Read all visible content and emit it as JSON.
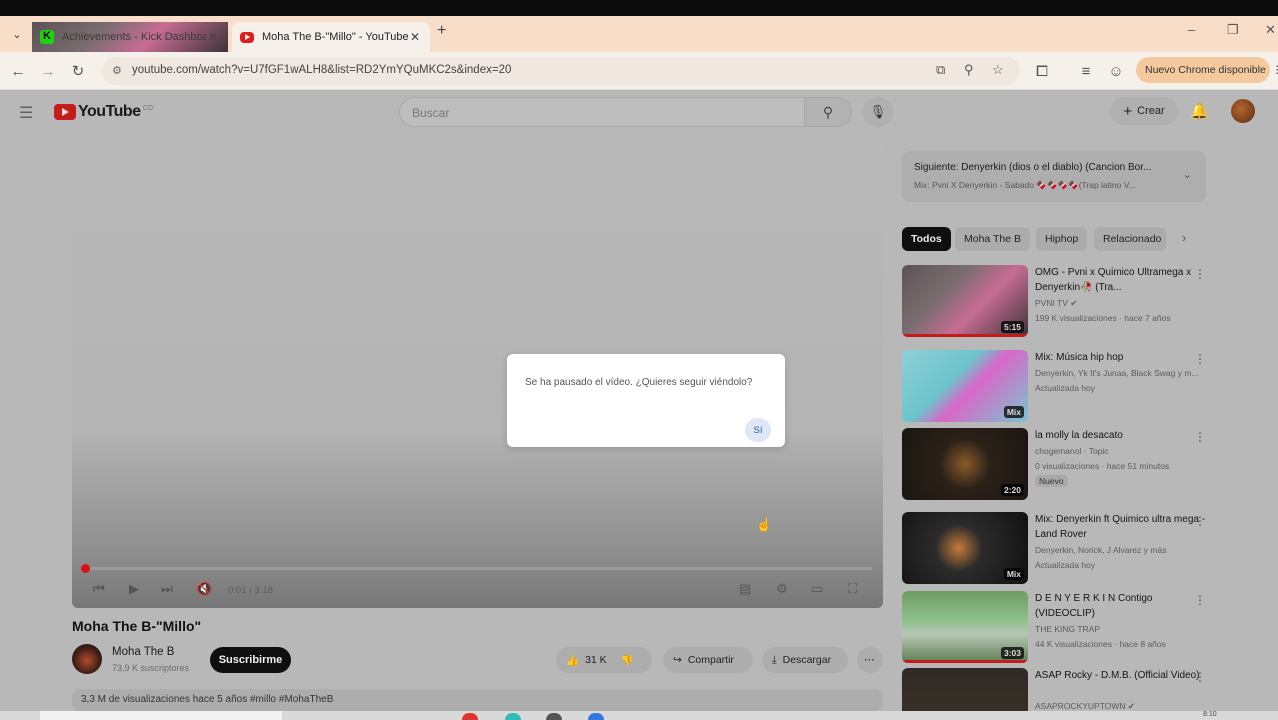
{
  "browser": {
    "tabs": [
      {
        "title": "Achievements - Kick Dashboard",
        "favicon": "kick-icon"
      },
      {
        "title": "Moha The B-\"Millo\" - YouTube",
        "favicon": "youtube-icon"
      }
    ],
    "url": "youtube.com/watch?v=U7fGF1wALH8&list=RD2YmYQuMKC2s&index=20",
    "update_button": "Nuevo Chrome disponible"
  },
  "youtube": {
    "logo_text": "YouTube",
    "logo_superscript": "CO",
    "search_placeholder": "Buscar",
    "create_label": "Crear"
  },
  "player": {
    "time": "0:01 / 3:18",
    "modal_text": "Se ha pausado el vídeo. ¿Quieres seguir viéndolo?",
    "modal_button": "Sí"
  },
  "video": {
    "title": "Moha The B-\"Millo\"",
    "channel": "Moha The B",
    "subscribers": "73,9 K suscriptores",
    "subscribe_label": "Suscribirme",
    "likes": "31 K",
    "share_label": "Compartir",
    "download_label": "Descargar",
    "description": "3,3 M de visualizaciones  hace 5 años  #millo #MohaTheB"
  },
  "upnext": {
    "line1": "Siguiente: Denyerkin (dios o el diablo) (Cancion Bor...",
    "line2": "Mix: Pvni X Denyerkin - Sabado 🍫🍫🍫🍫(Trap latino V..."
  },
  "chips": [
    "Todos",
    "Moha The B",
    "Hiphop",
    "Relacionado"
  ],
  "related": [
    {
      "title": "OMG - Pvni x Quimico Ultramega x Denyerkin🥀 (Tra...",
      "channel": "PVNI TV ✔",
      "meta": "199 K visualizaciones · hace 7 años",
      "duration": "5:15",
      "badge": ""
    },
    {
      "title": "Mix: Música hip hop",
      "channel": "Denyerkin, Yk It's Junaa, Black Swag y m...",
      "meta": "Actualizada hoy",
      "duration": "Mix",
      "badge": ""
    },
    {
      "title": "la molly la desacato",
      "channel": "chogemanol · Topic",
      "meta": "0 visualizaciones · hace 51 minutos",
      "duration": "2:20",
      "badge": "Nuevo"
    },
    {
      "title": "Mix: Denyerkin ft Quimico ultra mega - Land Rover",
      "channel": "Denyerkin, Norick, J Alvarez y más",
      "meta": "Actualizada hoy",
      "duration": "Mix",
      "badge": ""
    },
    {
      "title": "D E N Y E R K I N  Contigo (VIDEOCLIP)",
      "channel": "THE KING TRAP",
      "meta": "44 K visualizaciones · hace 8 años",
      "duration": "3:03",
      "badge": ""
    },
    {
      "title": "ASAP Rocky - D.M.B. (Official Video)",
      "channel": "ASAPROCKYUPTOWN ✔",
      "meta": "",
      "duration": "",
      "badge": ""
    }
  ],
  "taskbar": {
    "time": "8:10"
  }
}
